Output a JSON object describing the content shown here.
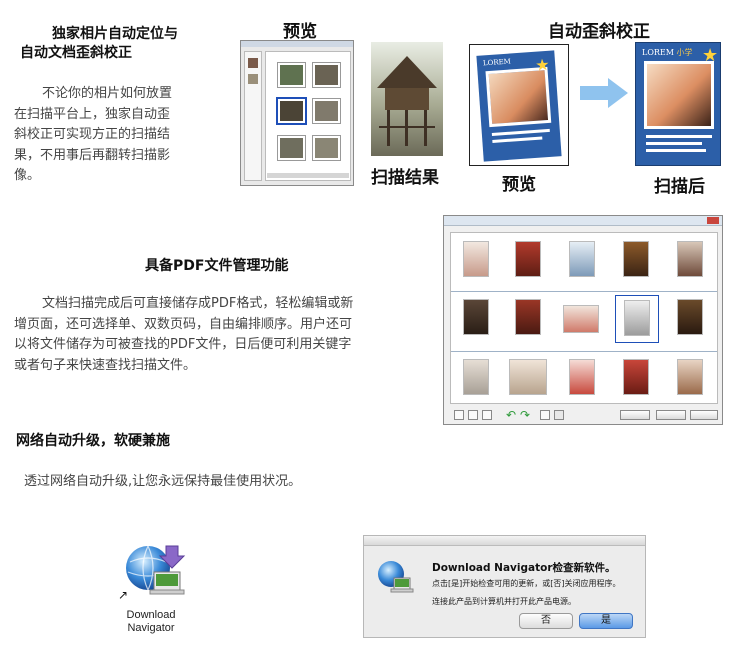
{
  "section1": {
    "title_line1": "独家相片自动定位与",
    "title_line2": "自动文档歪斜校正",
    "para_lines": [
      "不论你的相片如何放置",
      "在扫描平台上，独家自动歪",
      "斜校正可实现方正的扫描结",
      "果，不用事后再翻转扫描影",
      "像。"
    ],
    "label_preview": "预览",
    "label_deskew": "自动歪斜校正",
    "label_scan_result": "扫描结果",
    "label_preview2": "预览",
    "label_after_scan": "扫描后",
    "magazine_title": "LOREM",
    "magazine_sub": "小学"
  },
  "section2": {
    "title": "具备PDF文件管理功能",
    "para_lines": [
      "文档扫描完成后可直接储存成PDF格式，轻松编辑或新",
      "增页面，还可选择单、双数页码，自由编排顺序。用户还可",
      "以将文件储存为可被查找的PDF文件，日后便可利用关键字",
      "或者句子来快速查找扫描文件。"
    ]
  },
  "section3": {
    "title": "网络自动升级，软硬兼施",
    "para": "透过网络自动升级,让您永远保持最佳使用状况。",
    "app_label_line1": "Download",
    "app_label_line2": "Navigator",
    "dialog": {
      "title": "Download Navigator检查新软件。",
      "line1": "点击[是]开始检查可用的更新，或[否]关闭应用程序。",
      "line2": "连接此产品到计算机并打开此产品电源。",
      "btn_no": "否",
      "btn_yes": "是"
    }
  },
  "colors": {
    "arrow": "#8fc3ee",
    "mag_blue": "#2c5fa8",
    "selection": "#1e4fb8",
    "dialog_default": "#5b9ae6"
  }
}
